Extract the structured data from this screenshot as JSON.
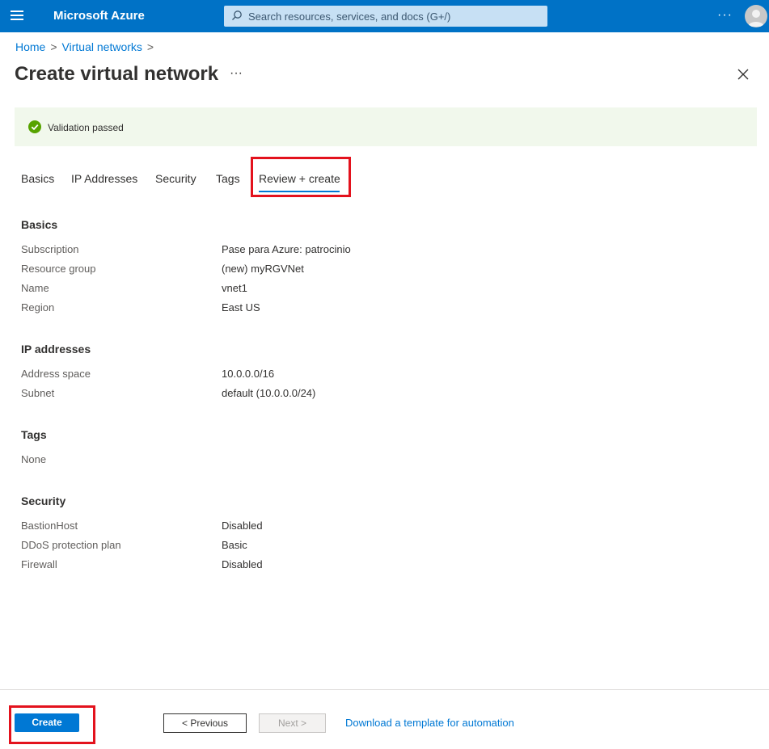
{
  "app": {
    "brand": "Microsoft Azure",
    "search_placeholder": "Search resources, services, and docs (G+/)",
    "more": "···"
  },
  "breadcrumb": {
    "home": "Home",
    "separator": ">",
    "virtual_networks": "Virtual networks"
  },
  "page": {
    "title": "Create virtual network",
    "more": "···"
  },
  "banner": {
    "text": "Validation passed"
  },
  "tabs": [
    {
      "label": "Basics"
    },
    {
      "label": "IP Addresses"
    },
    {
      "label": "Security"
    },
    {
      "label": "Tags"
    },
    {
      "label": "Review + create",
      "active": true
    }
  ],
  "review": {
    "basics": {
      "title": "Basics",
      "rows": [
        {
          "label": "Subscription",
          "value": "Pase para Azure: patrocinio"
        },
        {
          "label": "Resource group",
          "value": "(new) myRGVNet"
        },
        {
          "label": "Name",
          "value": "vnet1"
        },
        {
          "label": "Region",
          "value": "East US"
        }
      ]
    },
    "ip_addresses": {
      "title": "IP addresses",
      "rows": [
        {
          "label": "Address space",
          "value": "10.0.0.0/16"
        },
        {
          "label": "Subnet",
          "value": "default (10.0.0.0/24)"
        }
      ]
    },
    "tags": {
      "title": "Tags",
      "none": "None"
    },
    "security": {
      "title": "Security",
      "rows": [
        {
          "label": "BastionHost",
          "value": "Disabled"
        },
        {
          "label": "DDoS protection plan",
          "value": "Basic"
        },
        {
          "label": "Firewall",
          "value": "Disabled"
        }
      ]
    }
  },
  "footer": {
    "create": "Create",
    "previous": "< Previous",
    "next": "Next >",
    "download": "Download a template for automation"
  },
  "colors": {
    "topbar": "#0072c6",
    "accent": "#0078d4",
    "success": "#57a300",
    "highlight": "#e3121d"
  }
}
